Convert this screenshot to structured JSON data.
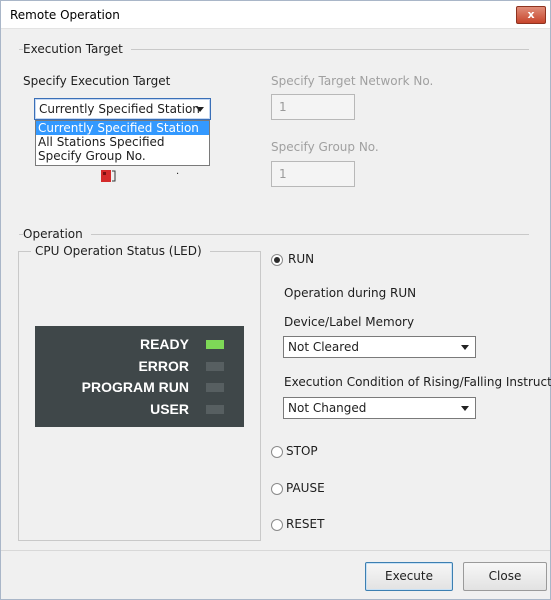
{
  "window": {
    "title": "Remote Operation",
    "close_label": "x"
  },
  "execution_target": {
    "group_label": "Execution Target",
    "specify_label": "Specify Execution Target",
    "selected_value": "Currently Specified Station",
    "options": [
      "Currently Specified Station",
      "All Stations Specified",
      "Specify Group No."
    ],
    "network_label": "Specify Target Network No.",
    "network_value": "1",
    "group_no_label": "Specify Group No.",
    "group_no_value": "1"
  },
  "operation": {
    "group_label": "Operation",
    "cpu_status_label": "CPU Operation Status (LED)",
    "leds": [
      {
        "label": "READY",
        "state": "on",
        "color": "#7ed857"
      },
      {
        "label": "ERROR",
        "state": "off",
        "color": "#575f61"
      },
      {
        "label": "PROGRAM RUN",
        "state": "off",
        "color": "#575f61"
      },
      {
        "label": "USER",
        "state": "off",
        "color": "#575f61"
      }
    ],
    "run_label": "RUN",
    "run_checked": true,
    "operation_during_run_label": "Operation during RUN",
    "device_memory_label": "Device/Label Memory",
    "device_memory_value": "Not Cleared",
    "rising_falling_label": "Execution Condition of Rising/Falling Instruction",
    "rising_falling_value": "Not Changed",
    "stop_label": "STOP",
    "pause_label": "PAUSE",
    "reset_label": "RESET"
  },
  "footer": {
    "execute_label": "Execute",
    "close_label": "Close"
  }
}
